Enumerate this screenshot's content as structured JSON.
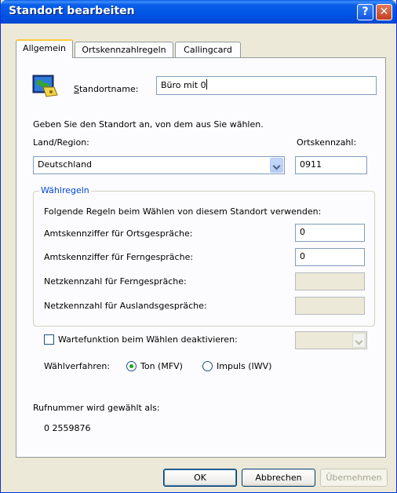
{
  "window": {
    "title": "Standort bearbeiten"
  },
  "titlebar_buttons": {
    "help": "?",
    "close": "✕"
  },
  "tabs": [
    {
      "label": "Allgemein",
      "active": true
    },
    {
      "label": "Ortskennzahlregeln",
      "active": false
    },
    {
      "label": "Callingcard",
      "active": false
    }
  ],
  "location": {
    "name_label": "Standortname:",
    "name_value": "Büro mit 0"
  },
  "instruction": "Geben Sie den Standort an, von dem aus Sie wählen.",
  "country": {
    "label": "Land/Region:",
    "value": "Deutschland"
  },
  "area_code": {
    "label": "Ortskennzahl:",
    "value": "0911"
  },
  "dialing_rules": {
    "legend": "Wählregeln",
    "intro": "Folgende Regeln beim Wählen von diesem Standort verwenden:",
    "rows": [
      {
        "label": "Amtskennziffer für Ortsgespräche:",
        "value": "0",
        "enabled": true
      },
      {
        "label": "Amtskennziffer für Ferngespräche:",
        "value": "0",
        "enabled": true
      },
      {
        "label": "Netzkennzahl für Ferngespräche:",
        "value": "",
        "enabled": false
      },
      {
        "label": "Netzkennzahl für Auslandsgespräche:",
        "value": "",
        "enabled": false
      }
    ]
  },
  "call_waiting": {
    "label": "Wartefunktion beim Wählen deaktivieren:",
    "checked": false,
    "value": ""
  },
  "dial_mode": {
    "label": "Wählverfahren:",
    "options": [
      {
        "label": "Ton (MFV)",
        "selected": true
      },
      {
        "label": "Impuls (IWV)",
        "selected": false
      }
    ]
  },
  "dialed_as": {
    "label": "Rufnummer wird gewählt als:",
    "number": "0 2559876"
  },
  "buttons": {
    "ok": "OK",
    "cancel": "Abbrechen",
    "apply": "Übernehmen"
  },
  "colors": {
    "title_blue": "#0055e5",
    "group_legend": "#0046d5",
    "tab_highlight": "#ffc83c"
  }
}
